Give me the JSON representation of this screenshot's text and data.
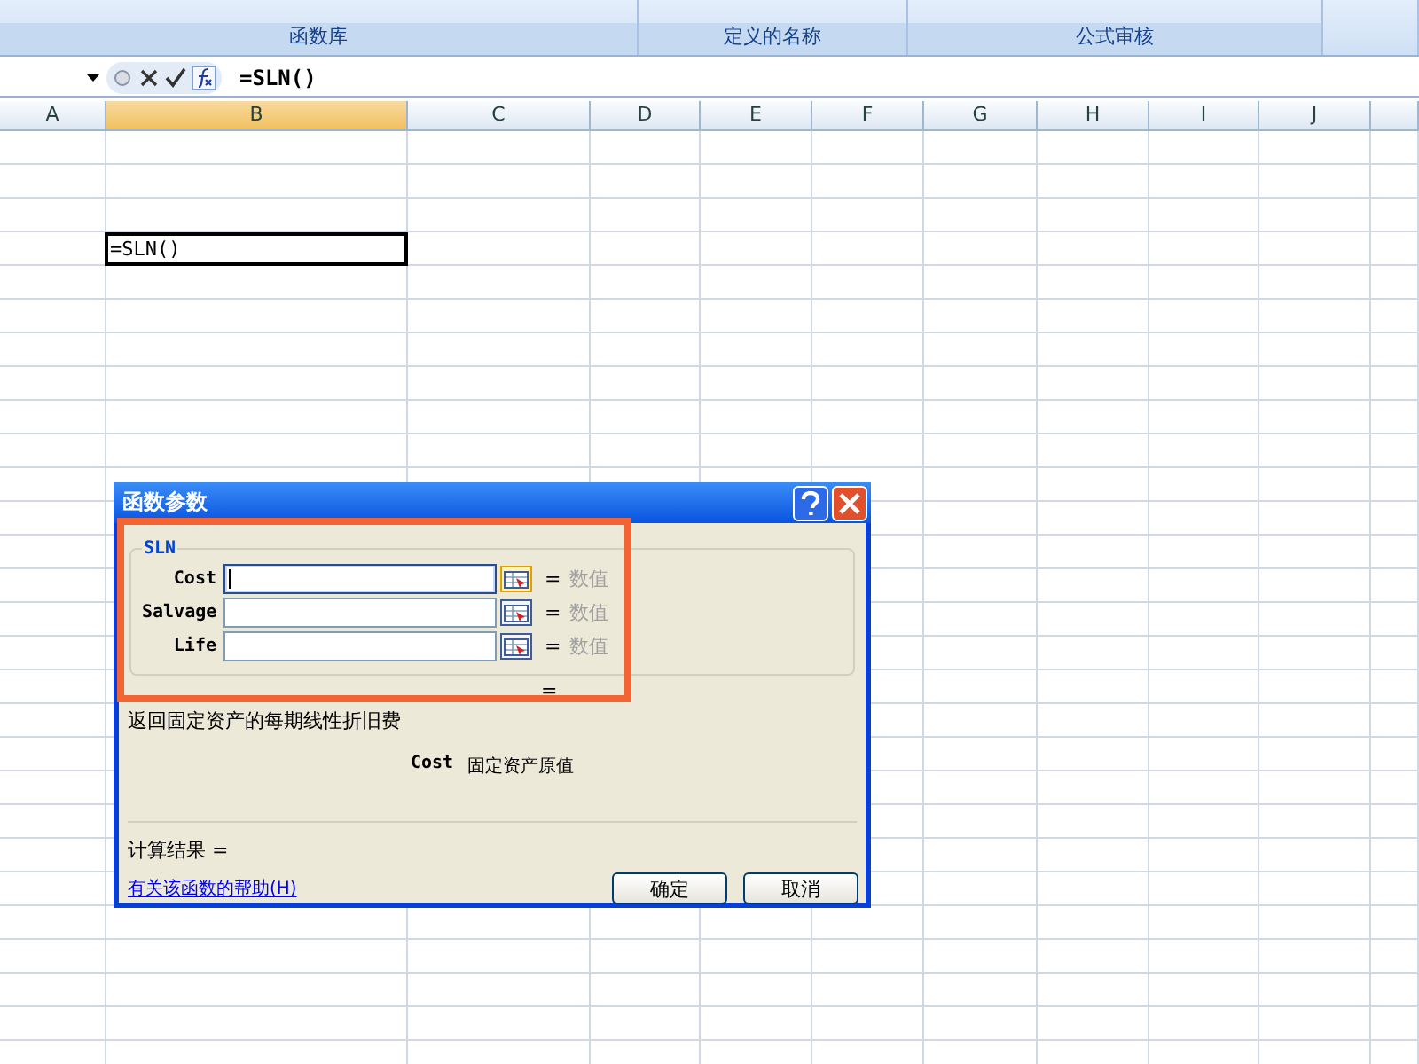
{
  "ribbon": {
    "groups": [
      {
        "label": "函数库"
      },
      {
        "label": "定义的名称"
      },
      {
        "label": "公式审核"
      }
    ]
  },
  "formula_bar": {
    "formula": "=SLN()"
  },
  "columns": [
    {
      "label": "A",
      "selected": false
    },
    {
      "label": "B",
      "selected": true
    },
    {
      "label": "C",
      "selected": false
    },
    {
      "label": "D",
      "selected": false
    },
    {
      "label": "E",
      "selected": false
    },
    {
      "label": "F",
      "selected": false
    },
    {
      "label": "G",
      "selected": false
    },
    {
      "label": "H",
      "selected": false
    },
    {
      "label": "I",
      "selected": false
    },
    {
      "label": "J",
      "selected": false
    }
  ],
  "active_cell": {
    "value": "=SLN()"
  },
  "dialog": {
    "title": "函数参数",
    "function_name": "SLN",
    "args": [
      {
        "label": "Cost",
        "equals": "=",
        "hint": "数值",
        "focused": true
      },
      {
        "label": "Salvage",
        "equals": "=",
        "hint": "数值",
        "focused": false
      },
      {
        "label": "Life",
        "equals": "=",
        "hint": "数值",
        "focused": false
      }
    ],
    "total_equals": "=",
    "description": "返回固定资产的每期线性折旧费",
    "arg_name": "Cost",
    "arg_help": "固定资产原值",
    "result_label": "计算结果 =",
    "help_link": "有关该函数的帮助(H)",
    "buttons": [
      {
        "label": "确定"
      },
      {
        "label": "取消"
      }
    ]
  }
}
